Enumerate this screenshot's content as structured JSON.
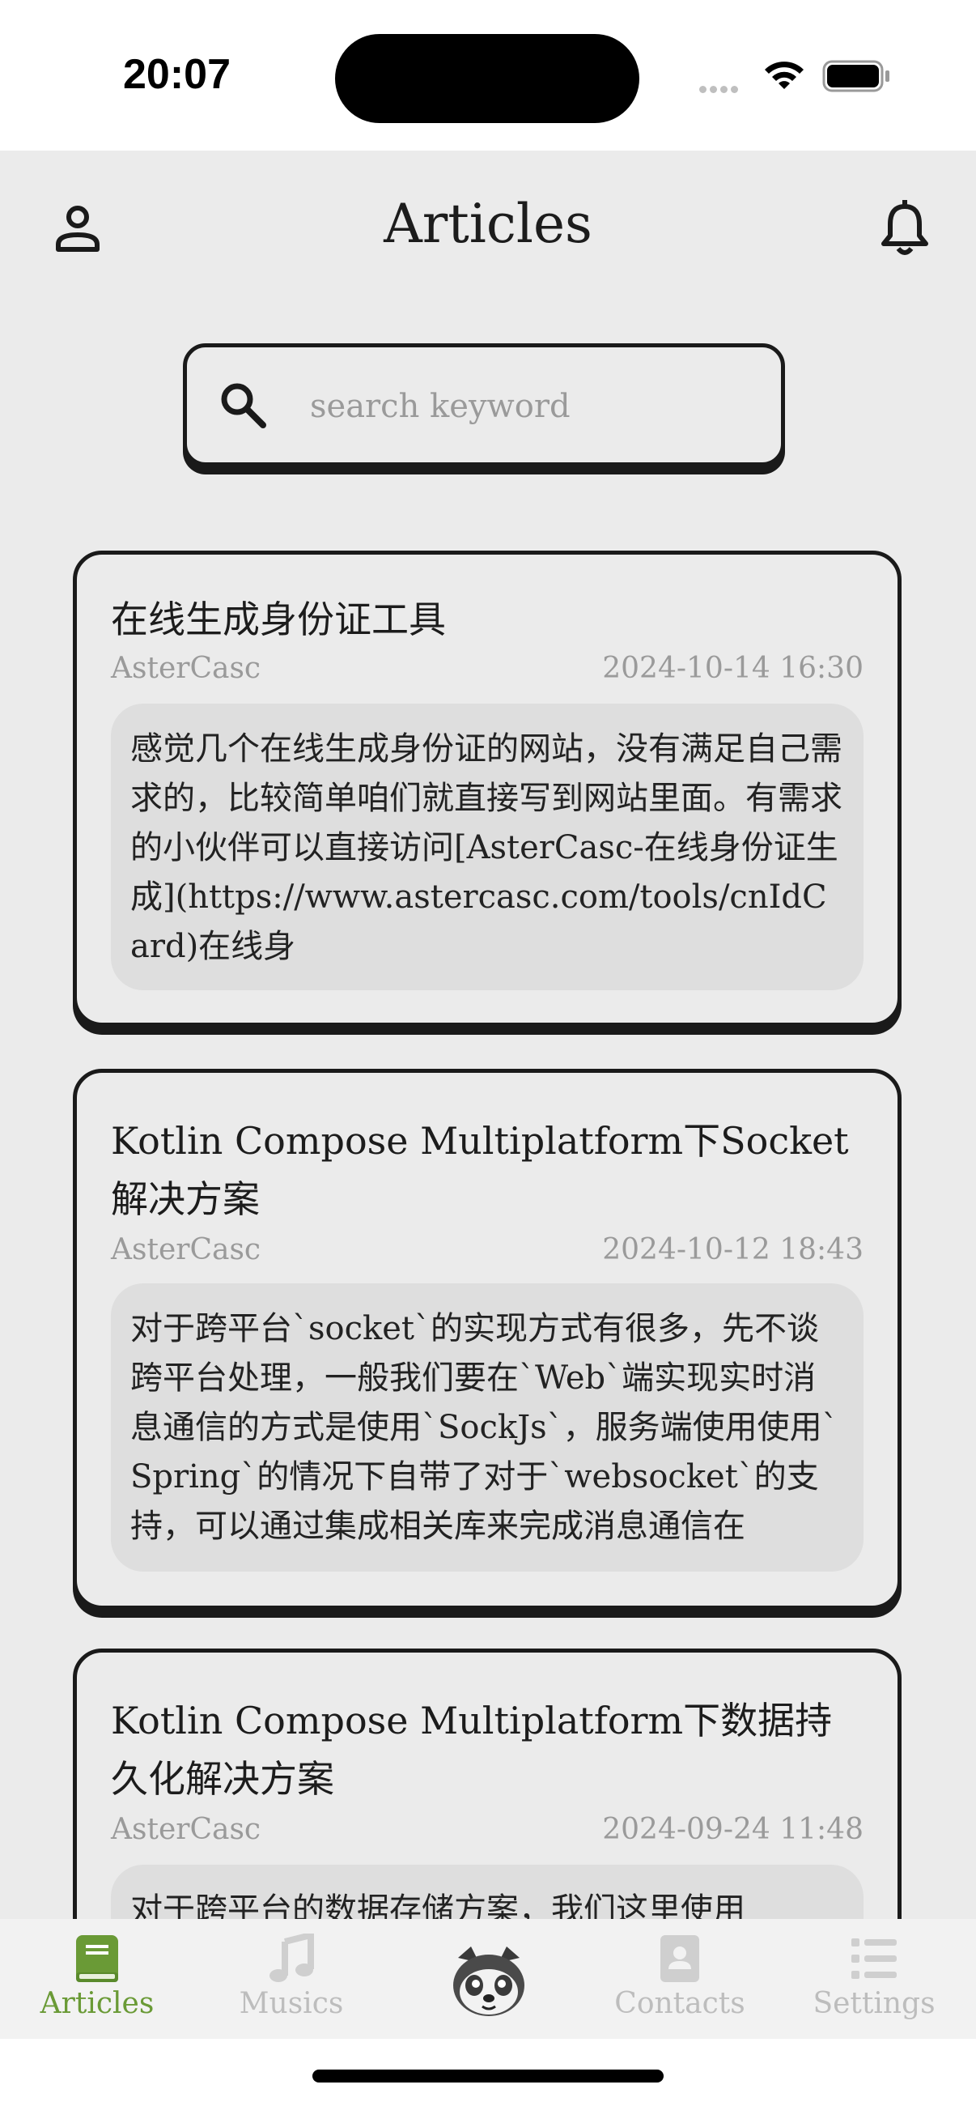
{
  "status": {
    "time": "20:07"
  },
  "header": {
    "title": "Articles"
  },
  "search": {
    "placeholder": "search keyword",
    "value": ""
  },
  "articles": [
    {
      "title": "在线生成身份证工具",
      "author": "AsterCasc",
      "date": "2024-10-14 16:30",
      "excerpt": "感觉几个在线生成身份证的网站，没有满足自己需求的，比较简单咱们就直接写到网站里面。有需求的小伙伴可以直接访问[AsterCasc-在线身份证生成](https://www.astercasc.com/tools/cnIdCard)在线身"
    },
    {
      "title": "Kotlin Compose Multiplatform下Socket解决方案",
      "author": "AsterCasc",
      "date": "2024-10-12 18:43",
      "excerpt": "对于跨平台`socket`的实现方式有很多，先不谈跨平台处理，一般我们要在`Web`端实现实时消息通信的方式是使用`SockJs`，服务端使用使用`Spring`的情况下自带了对于`websocket`的支持，可以通过集成相关库来完成消息通信在"
    },
    {
      "title": "Kotlin Compose Multiplatform下数据持久化解决方案",
      "author": "AsterCasc",
      "date": "2024-09-24 11:48",
      "excerpt": "对于跨平台的数据存储方案，我们这里使用"
    }
  ],
  "tabs": [
    {
      "label": "Articles",
      "icon": "book-icon",
      "active": true
    },
    {
      "label": "Musics",
      "icon": "music-note-icon",
      "active": false
    },
    {
      "label": "",
      "icon": "red-panda-mascot-icon",
      "active": false
    },
    {
      "label": "Contacts",
      "icon": "contact-card-icon",
      "active": false
    },
    {
      "label": "Settings",
      "icon": "list-icon",
      "active": false
    }
  ],
  "colors": {
    "accent": "#6a9a36",
    "background": "#ebebeb",
    "border": "#1a1a1a",
    "muted": "#9a9a9a"
  }
}
